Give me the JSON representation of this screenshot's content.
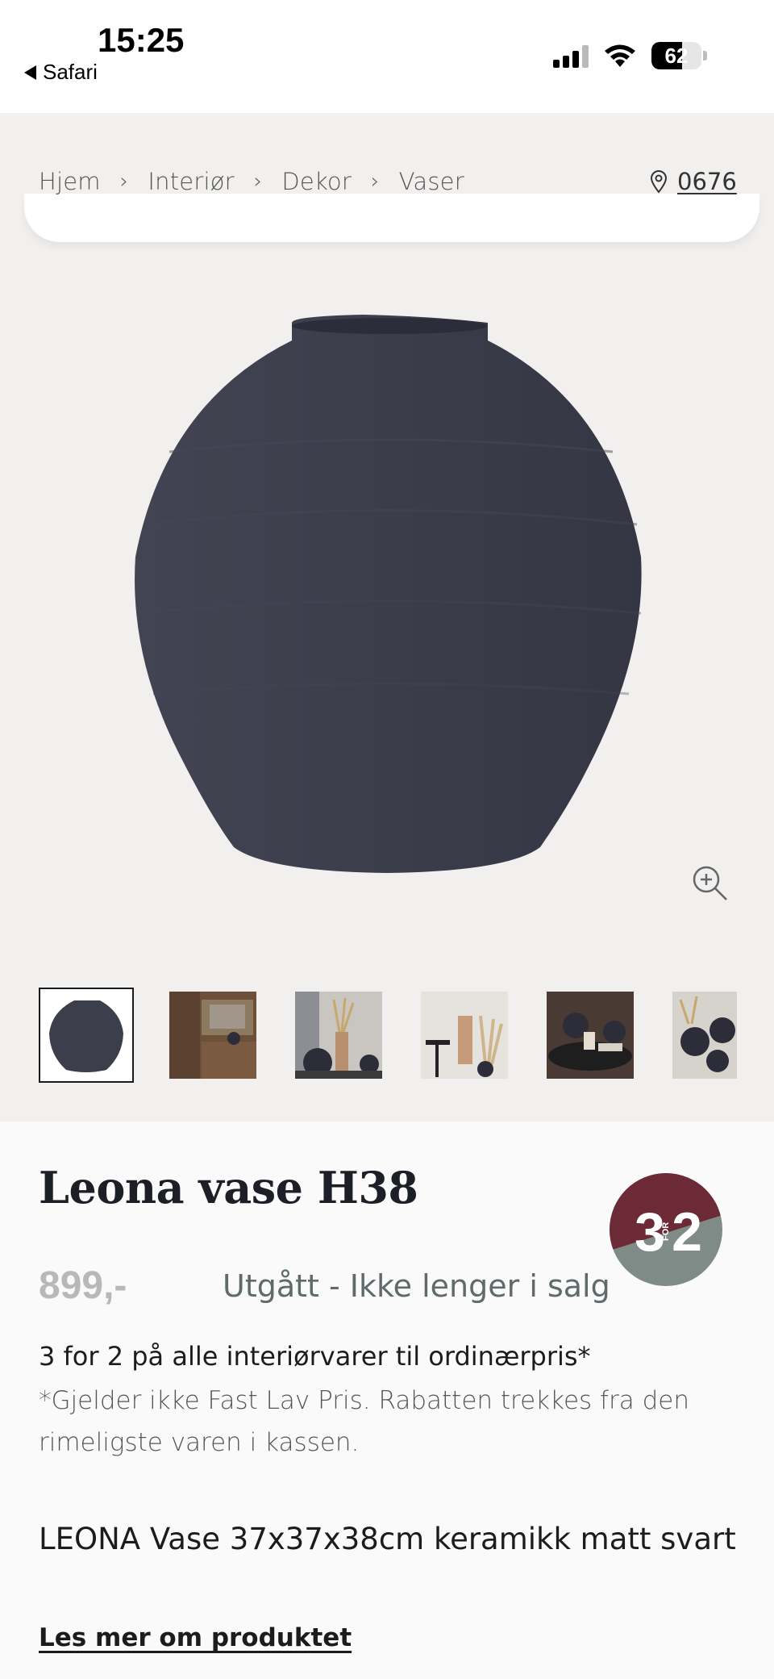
{
  "status_bar": {
    "time": "15:25",
    "back_label": "Safari",
    "battery": "62",
    "battery_level": 0.62
  },
  "breadcrumb": {
    "items": [
      "Hjem",
      "Interiør",
      "Dekor",
      "Vaser"
    ]
  },
  "store": {
    "code": "0676"
  },
  "product": {
    "title": "Leona vase H38",
    "price": "899,-",
    "status": "Utgått - Ikke lenger i salg",
    "promo_heading": "3 for 2 på alle interiørvarer til ordinærpris*",
    "promo_note": "*Gjelder ikke Fast Lav Pris. Rabatten trekkes fra den rimeligste varen i kassen.",
    "description": "LEONA Vase 37x37x38cm keramikk matt svart",
    "read_more": "Les mer om produktet"
  },
  "badge": {
    "left_digit": "3",
    "right_digit": "2",
    "middle": "FOR"
  },
  "colors": {
    "badge_top": "#6b2a35",
    "badge_bottom": "#7f8b87",
    "vase": "#3d3e4c",
    "background_gray": "#f2f0ef"
  },
  "thumbnails": [
    "vase-product",
    "interior-shelf",
    "vases-grass",
    "room-towel",
    "table-candles",
    "vases-group"
  ]
}
